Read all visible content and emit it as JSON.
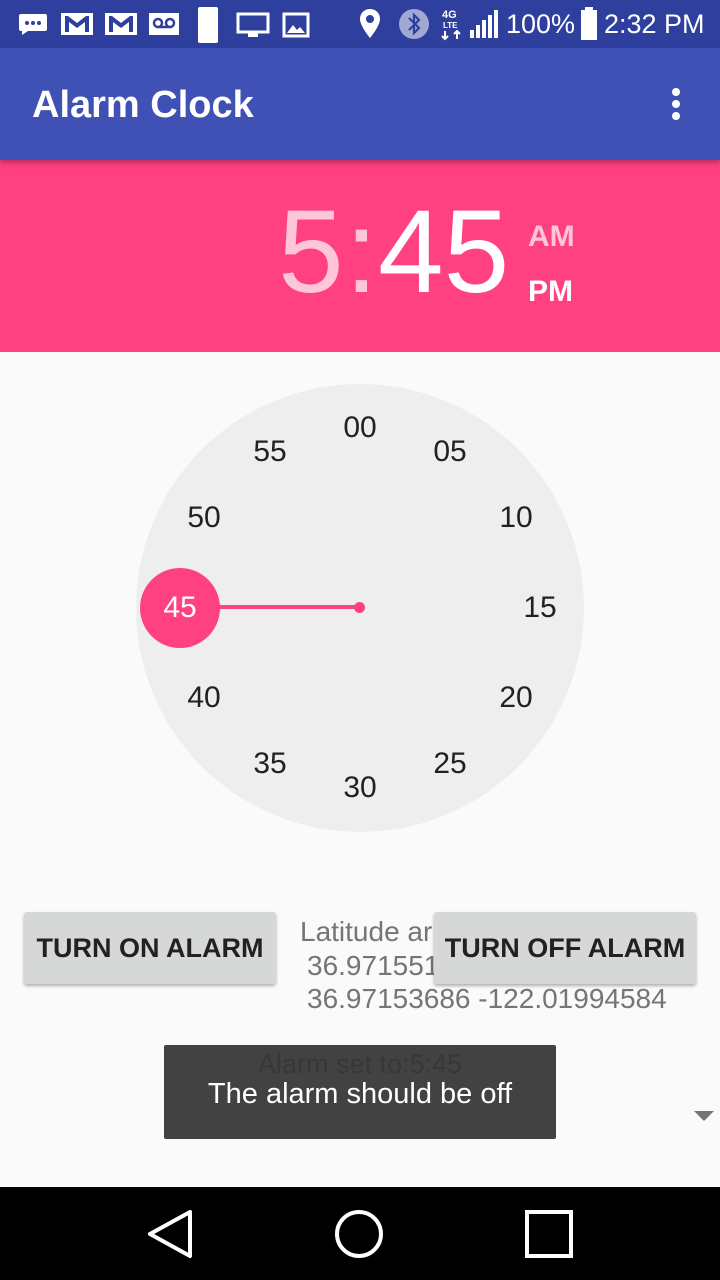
{
  "status_bar": {
    "battery_percent": "100%",
    "time": "2:32 PM",
    "network": "4G LTE",
    "icons": [
      "messaging-icon",
      "gmail-icon",
      "gmail-icon",
      "voicemail-icon",
      "sim-icon",
      "cast-icon",
      "image-icon",
      "location-icon",
      "bluetooth-icon",
      "network-4g-icon",
      "signal-icon",
      "battery-icon"
    ]
  },
  "app_bar": {
    "title": "Alarm Clock",
    "menu_icon": "more-vert-icon"
  },
  "time_header": {
    "hour": "5",
    "colon": ":",
    "minute": "45",
    "am_label": "AM",
    "pm_label": "PM",
    "selected_period": "PM"
  },
  "dial": {
    "numbers": [
      "00",
      "05",
      "10",
      "15",
      "20",
      "25",
      "30",
      "35",
      "40",
      "45",
      "50",
      "55"
    ],
    "selected_value": "45"
  },
  "buttons": {
    "turn_on": "TURN ON ALARM",
    "turn_off": "TURN OFF ALARM"
  },
  "location": {
    "label": "Latitude ar",
    "coords_line_1": "36.971551",
    "coords_line_2": "36.97153686 -122.01994584"
  },
  "alarm_status": "Alarm set to:5:45",
  "toast": {
    "message": "The alarm should be off"
  },
  "nav_bar": {
    "back": "back-icon",
    "home": "home-icon",
    "recents": "recents-icon"
  },
  "colors": {
    "primary": "#3f51b5",
    "primary_dark": "#2f3f9e",
    "accent": "#ff4081"
  }
}
